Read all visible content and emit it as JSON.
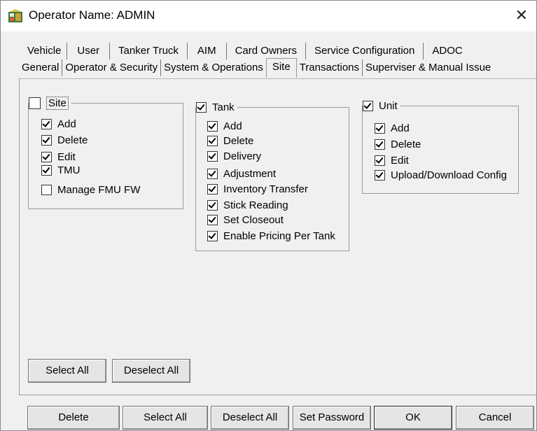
{
  "window": {
    "title": "Operator Name: ADMIN",
    "close_symbol": "✕"
  },
  "tabs_row1": [
    "Vehicle",
    "User",
    "Tanker Truck",
    "AIM",
    "Card Owners",
    "Service Configuration",
    "ADOC"
  ],
  "tabs_row2": [
    "General",
    "Operator & Security",
    "System & Operations",
    "Site",
    "Transactions",
    "Superviser & Manual Issue"
  ],
  "active_tab": "Site",
  "groups": {
    "site": {
      "label": "Site",
      "checked": false,
      "items": [
        {
          "label": "Add",
          "checked": true
        },
        {
          "label": "Delete",
          "checked": true
        },
        {
          "label": "Edit",
          "checked": true
        },
        {
          "label": "TMU",
          "checked": true
        },
        {
          "label": "Manage FMU FW",
          "checked": false
        }
      ]
    },
    "tank": {
      "label": "Tank",
      "checked": true,
      "items": [
        {
          "label": "Add",
          "checked": true
        },
        {
          "label": "Delete",
          "checked": true
        },
        {
          "label": "Delivery",
          "checked": true
        },
        {
          "label": "Adjustment",
          "checked": true
        },
        {
          "label": "Inventory Transfer",
          "checked": true
        },
        {
          "label": "Stick Reading",
          "checked": true
        },
        {
          "label": "Set Closeout",
          "checked": true
        },
        {
          "label": "Enable Pricing Per Tank",
          "checked": true
        }
      ]
    },
    "unit": {
      "label": "Unit",
      "checked": true,
      "items": [
        {
          "label": "Add",
          "checked": true
        },
        {
          "label": "Delete",
          "checked": true
        },
        {
          "label": "Edit",
          "checked": true
        },
        {
          "label": "Upload/Download Config",
          "checked": true
        }
      ]
    }
  },
  "panel_buttons": {
    "select_all": "Select All",
    "deselect_all": "Deselect All"
  },
  "footer_buttons": {
    "delete": "Delete",
    "select_all": "Select All",
    "deselect_all": "Deselect All",
    "set_password": "Set Password",
    "ok": "OK",
    "cancel": "Cancel"
  }
}
